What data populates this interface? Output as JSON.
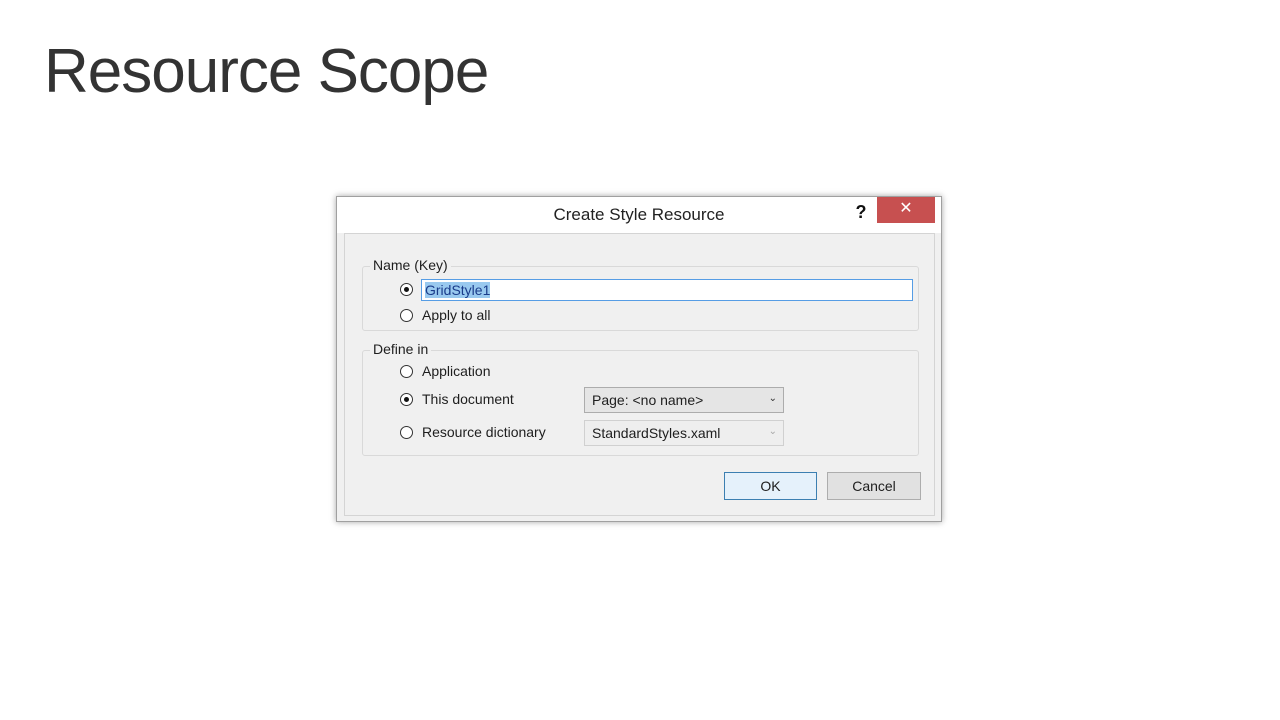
{
  "slide": {
    "title": "Resource Scope"
  },
  "dialog": {
    "title": "Create Style Resource",
    "help_label": "?",
    "close_label": "✕",
    "name_group": {
      "legend": "Name (Key)",
      "key_value": "GridStyle1",
      "apply_to_all_label": "Apply to all",
      "selected_option": "key"
    },
    "define_group": {
      "legend": "Define in",
      "application_label": "Application",
      "this_document_label": "This document",
      "this_document_value": "Page: <no name>",
      "resource_dictionary_label": "Resource dictionary",
      "resource_dictionary_value": "StandardStyles.xaml",
      "selected_option": "this_document"
    },
    "buttons": {
      "ok": "OK",
      "cancel": "Cancel"
    }
  },
  "icons": {
    "dropdown": "chevron-down-icon",
    "close": "close-icon",
    "help": "help-icon"
  },
  "colors": {
    "close_button": "#c75050",
    "ok_border": "#3c7fb1",
    "selection": "#99c9ef"
  }
}
